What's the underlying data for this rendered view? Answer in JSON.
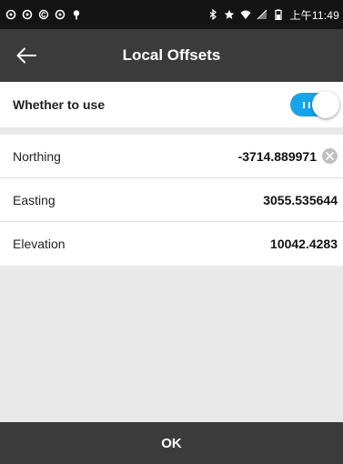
{
  "status_bar": {
    "time": "上午11:49",
    "icons": [
      "notification-icon",
      "notification-icon",
      "notification-icon",
      "notification-icon",
      "location-icon",
      "bluetooth-icon",
      "star-icon",
      "wifi-icon",
      "signal-icon",
      "battery-icon"
    ]
  },
  "header": {
    "title": "Local Offsets",
    "back_icon": "arrow-left-icon"
  },
  "use_toggle": {
    "label": "Whether to use",
    "on": true,
    "color": "#16a4ec"
  },
  "offsets": [
    {
      "label": "Northing",
      "value": "-3714.889971",
      "clearable": true
    },
    {
      "label": "Easting",
      "value": "3055.535644",
      "clearable": false
    },
    {
      "label": "Elevation",
      "value": "10042.4283",
      "clearable": false
    }
  ],
  "footer": {
    "ok_label": "OK"
  },
  "colors": {
    "app_bar": "#3b3b3b",
    "status_bar": "#141414",
    "background": "#e9e9e9"
  }
}
